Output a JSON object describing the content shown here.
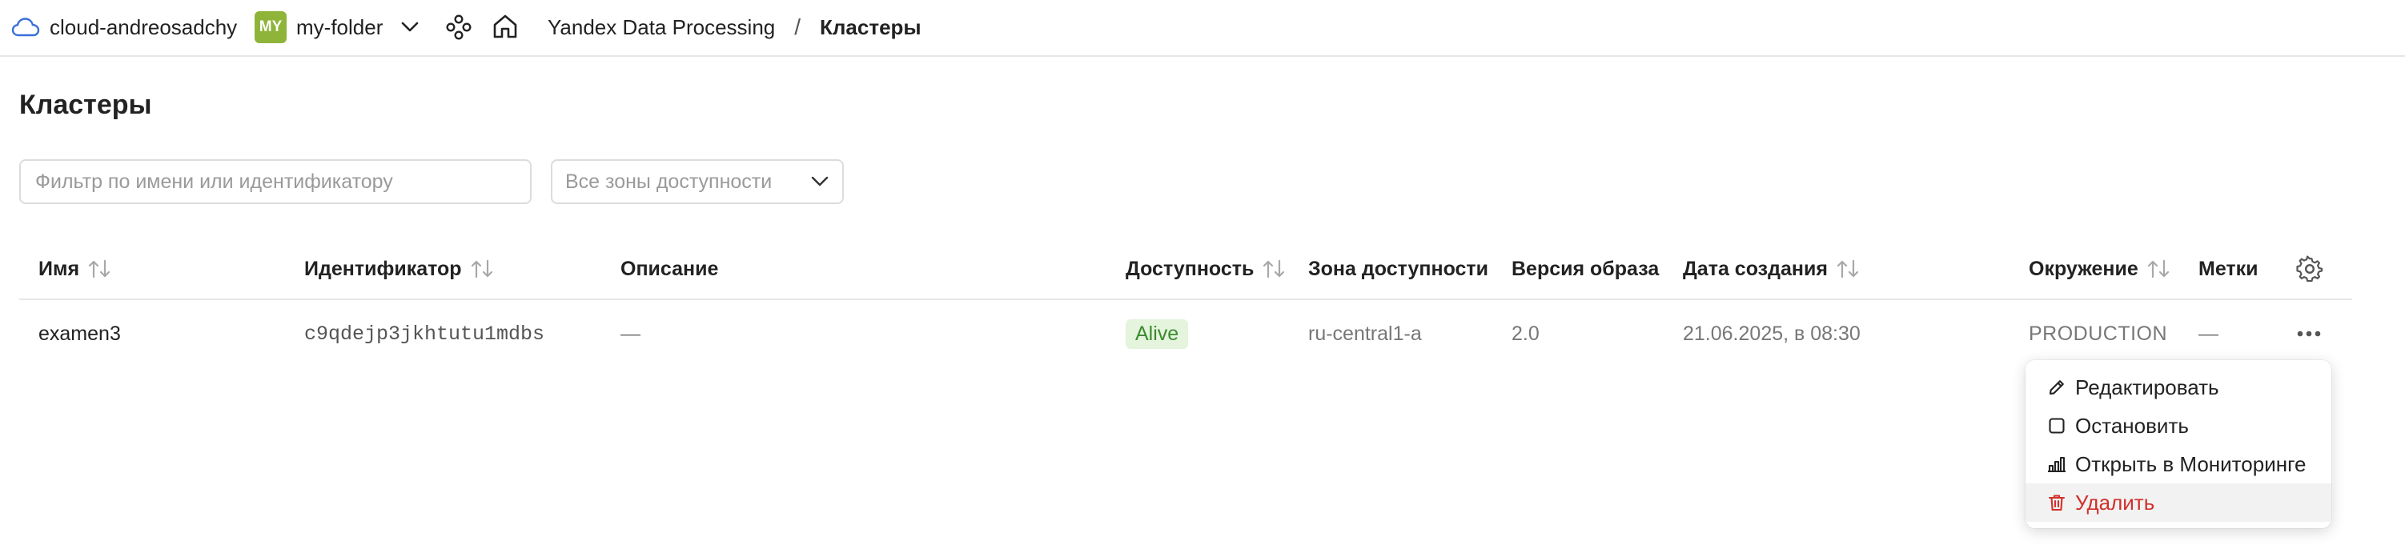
{
  "header": {
    "cloud_name": "cloud-andreosadchy",
    "folder_badge": "MY",
    "folder_name": "my-folder",
    "breadcrumb_service": "Yandex Data Processing",
    "breadcrumb_separator": "/",
    "breadcrumb_current": "Кластеры"
  },
  "page": {
    "title": "Кластеры"
  },
  "filters": {
    "search_placeholder": "Фильтр по имени или идентификатору",
    "search_value": "",
    "zone_select_value": "Все зоны доступности"
  },
  "table": {
    "columns": {
      "name": "Имя",
      "id": "Идентификатор",
      "description": "Описание",
      "availability": "Доступность",
      "zone": "Зона доступности",
      "image_version": "Версия образа",
      "created": "Дата создания",
      "environment": "Окружение",
      "labels": "Метки"
    },
    "rows": [
      {
        "name": "examen3",
        "id": "c9qdejp3jkhtutu1mdbs",
        "description": "—",
        "availability": "Alive",
        "zone": "ru-central1-a",
        "image_version": "2.0",
        "created": "21.06.2025, в 08:30",
        "environment": "PRODUCTION",
        "labels": "—"
      }
    ]
  },
  "actions_menu": {
    "items": [
      {
        "label": "Редактировать",
        "icon": "pencil-icon"
      },
      {
        "label": "Остановить",
        "icon": "stop-square-icon"
      },
      {
        "label": "Открыть в Мониторинге",
        "icon": "bar-chart-icon"
      },
      {
        "label": "Удалить",
        "icon": "trash-icon"
      }
    ]
  },
  "colors": {
    "folder_badge": "#8fb43a",
    "status_alive_bg": "#e4f4dd",
    "status_alive_text": "#3c8a2e",
    "danger": "#d0302a",
    "cloud_icon": "#3b6fd9"
  }
}
